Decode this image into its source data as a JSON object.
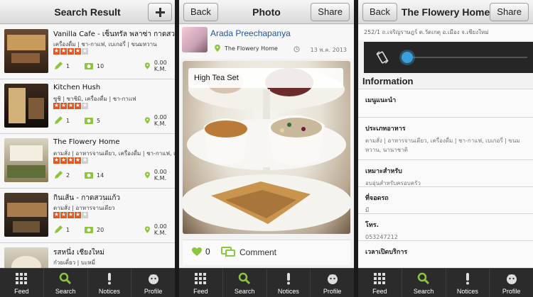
{
  "search": {
    "title": "Search Result",
    "add_label": "+",
    "results": [
      {
        "name": "Vanilla Cafe - เซ็นทรัล พลาซ่า กาดสวน",
        "category": "เครื่องดื่ม | ชา-กาแฟ, เบเกอรี่ | ขนมหวาน",
        "rating": 4,
        "reviews": "1",
        "photos": "10",
        "distance": "0.00 K.M."
      },
      {
        "name": "Kitchen Hush",
        "category": "ซูชิ | ซาชิมิ, เครื่องดื่ม | ชา-กาแฟ",
        "rating": 4,
        "reviews": "1",
        "photos": "5",
        "distance": "0.00 K.M."
      },
      {
        "name": "The Flowery Home",
        "category": "ตามสั่ง | อาหารจานเดียว, เครื่องดื่ม | ชา-กาแฟ, เบเกอรี่",
        "rating": 4,
        "reviews": "2",
        "photos": "14",
        "distance": "0.00 K.M."
      },
      {
        "name": "กินเส้น - กาดสวนแก้ว",
        "category": "ตามสั่ง | อาหารจานเดียว",
        "rating": 4,
        "reviews": "1",
        "photos": "20",
        "distance": "0.00 K.M."
      },
      {
        "name": "รสหนึ่ง เชียงใหม่",
        "category": "ก๋วยเตี๋ยว | บะหมี่",
        "rating": 4,
        "reviews": "",
        "photos": "",
        "distance": ""
      }
    ]
  },
  "photo": {
    "back_label": "Back",
    "title": "Photo",
    "share_label": "Share",
    "author": "Arada Preechapanya",
    "location": "The Flowery Home",
    "date": "13 พ.ค. 2013",
    "caption": "High Tea Set",
    "likes": "0",
    "comment_label": "Comment"
  },
  "place": {
    "back_label": "Back",
    "title": "The Flowery Home",
    "share_label": "Share",
    "address": "252/1 ถ.เจริญราษฎร์ ต.วัดเกตุ อ.เมือง จ.เชียงใหม่",
    "info_title": "Information",
    "sections": [
      {
        "heading": "เมนูแนะนำ",
        "value": ""
      },
      {
        "heading": "ประเภทอาหาร",
        "value": "ตามสั่ง | อาหารจานเดียว, เครื่องดื่ม | ชา-กาแฟ, เบเกอรี่ | ขนมหวาน, นานาชาติ"
      },
      {
        "heading": "เหมาะสำหรับ",
        "value": "อบอุ่นสำหรับครอบครัว"
      },
      {
        "heading": "ที่จอดรถ",
        "value": "มี"
      },
      {
        "heading": "โทร.",
        "value": "053247212"
      },
      {
        "heading": "เวลาเปิดบริการ",
        "value": ""
      }
    ]
  },
  "tabs": [
    "Feed",
    "Search",
    "Notices",
    "Profile"
  ],
  "colors": {
    "accent": "#8cc63f",
    "star": "#e8541a",
    "link": "#2554a7"
  }
}
